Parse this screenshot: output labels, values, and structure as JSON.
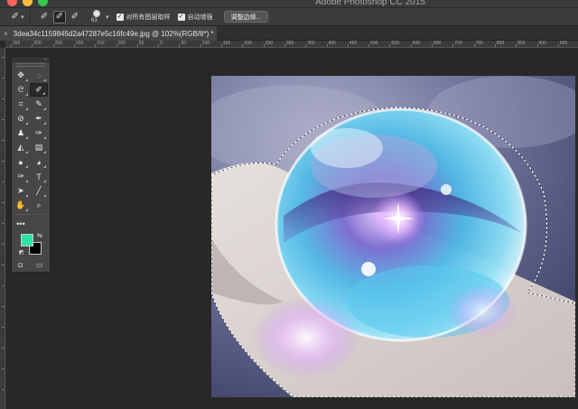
{
  "app": {
    "title": "Adobe Photoshop CC 2015"
  },
  "options_bar": {
    "brush_size": "63",
    "sample_all_layers": "对所有图层取样",
    "auto_enhance": "自动增强",
    "refine_edge": "调整边缘..."
  },
  "document": {
    "tab_title": "3dea34c1159845d2a47287e5c16fc49e.jpg @ 102%(RGB/8*) *",
    "close_glyph": "×"
  },
  "ruler": {
    "top_labels": [
      "350",
      "300",
      "250",
      "200",
      "150",
      "100",
      "50",
      "0",
      "50",
      "100",
      "150",
      "200",
      "250",
      "300",
      "350",
      "400",
      "450",
      "500",
      "550",
      "600",
      "650",
      "700",
      "750",
      "800",
      "850",
      "900",
      "950"
    ]
  },
  "toolbox": {
    "collapse_glyph": "‹‹",
    "close_glyph": "×",
    "foreground_color": "#2ee3a5",
    "background_color": "#000000"
  },
  "colors": {
    "accent_swatch": "#2ee3a5",
    "panel": "#464646",
    "workspace": "#282828"
  }
}
